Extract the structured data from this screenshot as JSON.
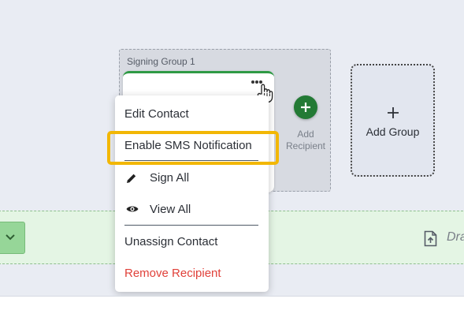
{
  "signing_group": {
    "title": "Signing Group 1"
  },
  "add_recipient": {
    "label": "Add Recipient"
  },
  "add_group": {
    "label": "Add Group"
  },
  "context_menu": {
    "items": [
      {
        "label": "Edit Contact"
      },
      {
        "label": "Enable SMS Notification"
      },
      {
        "label": "Sign All",
        "icon": "pencil-icon"
      },
      {
        "label": "View All",
        "icon": "eye-icon"
      },
      {
        "label": "Unassign Contact"
      },
      {
        "label": "Remove Recipient",
        "color": "#e0413a"
      }
    ]
  },
  "drop_zone": {
    "text": "Dra",
    "icon": "file-upload-icon"
  },
  "colors": {
    "highlight": "#f2b705",
    "accent_green": "#237a35",
    "drop_zone_bg": "#e4f5e4"
  }
}
